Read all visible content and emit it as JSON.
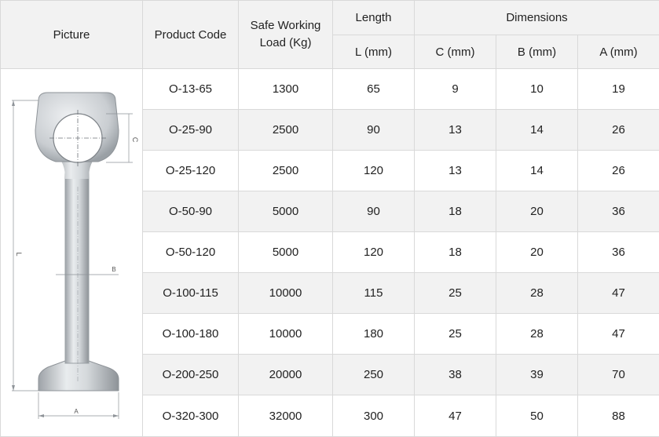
{
  "header": {
    "picture": "Picture",
    "product_code": "Product Code",
    "safe_working_load_line1": "Safe Working",
    "safe_working_load_line2": "Load (Kg)",
    "length": "Length",
    "dimensions": "Dimensions",
    "length_unit": "L (mm)",
    "c_unit": "C (mm)",
    "b_unit": "B (mm)",
    "a_unit": "A (mm)"
  },
  "diagram_labels": {
    "c": "C",
    "l": "L",
    "b": "B",
    "a": "A"
  },
  "rows": [
    {
      "code": "O-13-65",
      "load": "1300",
      "l": "65",
      "c": "9",
      "b": "10",
      "a": "19"
    },
    {
      "code": "O-25-90",
      "load": "2500",
      "l": "90",
      "c": "13",
      "b": "14",
      "a": "26"
    },
    {
      "code": "O-25-120",
      "load": "2500",
      "l": "120",
      "c": "13",
      "b": "14",
      "a": "26"
    },
    {
      "code": "O-50-90",
      "load": "5000",
      "l": "90",
      "c": "18",
      "b": "20",
      "a": "36"
    },
    {
      "code": "O-50-120",
      "load": "5000",
      "l": "120",
      "c": "18",
      "b": "20",
      "a": "36"
    },
    {
      "code": "O-100-115",
      "load": "10000",
      "l": "115",
      "c": "25",
      "b": "28",
      "a": "47"
    },
    {
      "code": "O-100-180",
      "load": "10000",
      "l": "180",
      "c": "25",
      "b": "28",
      "a": "47"
    },
    {
      "code": "O-200-250",
      "load": "20000",
      "l": "250",
      "c": "38",
      "b": "39",
      "a": "70"
    },
    {
      "code": "O-320-300",
      "load": "32000",
      "l": "300",
      "c": "47",
      "b": "50",
      "a": "88"
    }
  ]
}
